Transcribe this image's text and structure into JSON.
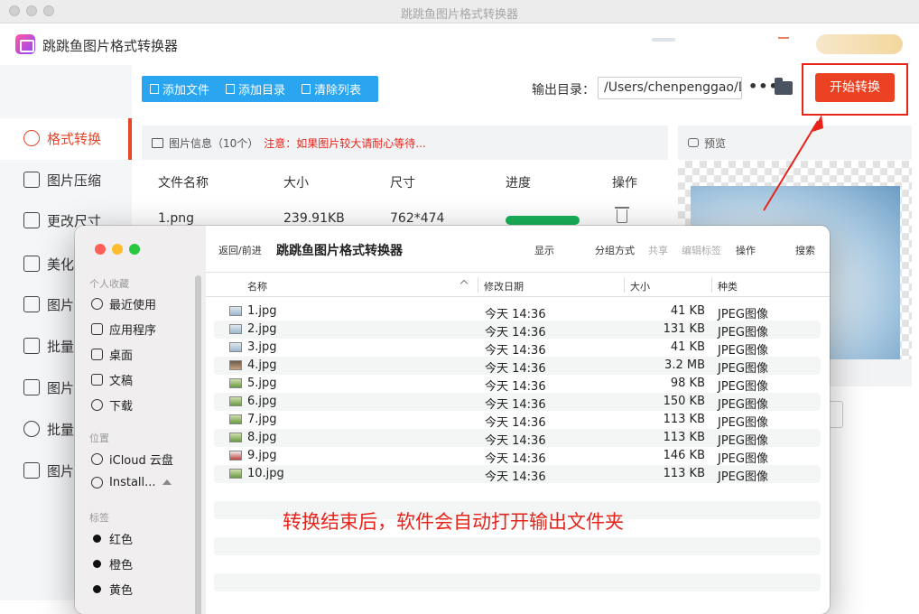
{
  "window": {
    "title": "跳跳鱼图片格式转换器"
  },
  "app": {
    "name": "跳跳鱼图片格式转换器"
  },
  "sidebar": {
    "items": [
      {
        "label": "格式转换"
      },
      {
        "label": "图片压缩"
      },
      {
        "label": "更改尺寸"
      },
      {
        "label": "美化"
      },
      {
        "label": "图片"
      },
      {
        "label": "批量"
      },
      {
        "label": "图片"
      },
      {
        "label": "批量"
      },
      {
        "label": "图片"
      }
    ]
  },
  "toolbar": {
    "add_file": "添加文件",
    "add_dir": "添加目录",
    "clear_list": "清除列表"
  },
  "output": {
    "label": "输出目录：",
    "path": "/Users/chenpenggao/D",
    "more": "•••",
    "start_label": "开始转换"
  },
  "fileinfo": {
    "title": "图片信息（10个）",
    "warning": "注意：如果图片较大请耐心等待..."
  },
  "table": {
    "headers": [
      "文件名称",
      "大小",
      "尺寸",
      "进度",
      "操作"
    ],
    "rows": [
      {
        "name": "1.png",
        "size": "239.91KB",
        "dims": "762*474",
        "progress": 1.0
      }
    ]
  },
  "preview": {
    "title": "预览"
  },
  "finder": {
    "nav": "返回/前进",
    "title": "跳跳鱼图片格式转换器",
    "toolbar": [
      "显示",
      "分组方式",
      "共享",
      "编辑标签",
      "操作",
      "搜索"
    ],
    "sections": {
      "favorites": "个人收藏",
      "locations": "位置",
      "tags": "标签"
    },
    "favorites": [
      "最近使用",
      "应用程序",
      "桌面",
      "文稿",
      "下载"
    ],
    "locations": [
      "iCloud 云盘",
      "Install..."
    ],
    "tags": [
      "红色",
      "橙色",
      "黄色"
    ],
    "columns": [
      "名称",
      "修改日期",
      "大小",
      "种类"
    ],
    "files": [
      {
        "name": "1.jpg",
        "date": "今天 14:36",
        "size": "41 KB",
        "kind": "JPEG图像"
      },
      {
        "name": "2.jpg",
        "date": "今天 14:36",
        "size": "131 KB",
        "kind": "JPEG图像"
      },
      {
        "name": "3.jpg",
        "date": "今天 14:36",
        "size": "41 KB",
        "kind": "JPEG图像"
      },
      {
        "name": "4.jpg",
        "date": "今天 14:36",
        "size": "3.2 MB",
        "kind": "JPEG图像"
      },
      {
        "name": "5.jpg",
        "date": "今天 14:36",
        "size": "98 KB",
        "kind": "JPEG图像"
      },
      {
        "name": "6.jpg",
        "date": "今天 14:36",
        "size": "150 KB",
        "kind": "JPEG图像"
      },
      {
        "name": "7.jpg",
        "date": "今天 14:36",
        "size": "113 KB",
        "kind": "JPEG图像"
      },
      {
        "name": "8.jpg",
        "date": "今天 14:36",
        "size": "113 KB",
        "kind": "JPEG图像"
      },
      {
        "name": "9.jpg",
        "date": "今天 14:36",
        "size": "146 KB",
        "kind": "JPEG图像"
      },
      {
        "name": "10.jpg",
        "date": "今天 14:36",
        "size": "113 KB",
        "kind": "JPEG图像"
      }
    ]
  },
  "annotation": {
    "text": "转换结束后，软件会自动打开输出文件夹"
  },
  "colors": {
    "accent": "#ec4224",
    "toolbar": "#2aa6f0",
    "progress": "#19b35b"
  }
}
